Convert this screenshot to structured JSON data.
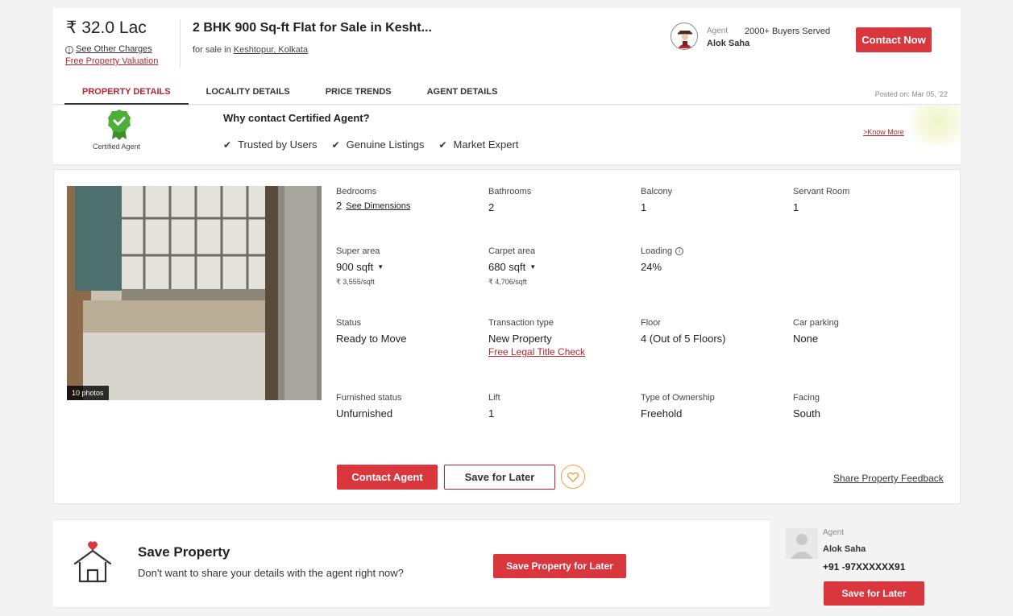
{
  "header": {
    "price": "₹ 32.0 Lac",
    "see_other_charges": "See Other Charges",
    "free_valuation": "Free Property Valuation",
    "title": "2 BHK 900 Sq-ft Flat for Sale in Kesht...",
    "subtitle_prefix": "for sale in ",
    "subtitle_location": "Keshtopur, Kolkata",
    "agent_label": "Agent",
    "agent_name": "Alok Saha",
    "buyers_served": "2000+ Buyers Served",
    "contact_now": "Contact Now",
    "posted_on": "Posted on: Mar 05, '22"
  },
  "tabs": [
    {
      "label": "PROPERTY DETAILS",
      "active": true
    },
    {
      "label": "LOCALITY DETAILS",
      "active": false
    },
    {
      "label": "PRICE TRENDS",
      "active": false
    },
    {
      "label": "AGENT DETAILS",
      "active": false
    }
  ],
  "certified": {
    "badge_label": "Certified Agent",
    "title": "Why contact Certified Agent?",
    "points": [
      "Trusted by Users",
      "Genuine Listings",
      "Market Expert"
    ],
    "know_more": ">Know More"
  },
  "photo": {
    "count_label": "10 photos"
  },
  "details": {
    "bedrooms": {
      "label": "Bedrooms",
      "value": "2",
      "link": "See Dimensions"
    },
    "bathrooms": {
      "label": "Bathrooms",
      "value": "2"
    },
    "balcony": {
      "label": "Balcony",
      "value": "1"
    },
    "servant_room": {
      "label": "Servant Room",
      "value": "1"
    },
    "super_area": {
      "label": "Super area",
      "value": "900 sqft",
      "sub": "₹ 3,555/sqft"
    },
    "carpet_area": {
      "label": "Carpet area",
      "value": "680 sqft",
      "sub": "₹ 4,706/sqft"
    },
    "loading": {
      "label": "Loading",
      "value": "24%"
    },
    "status": {
      "label": "Status",
      "value": "Ready to Move"
    },
    "transaction": {
      "label": "Transaction type",
      "value": "New Property",
      "link": "Free Legal Title Check"
    },
    "floor": {
      "label": "Floor",
      "value": "4 (Out of 5 Floors)"
    },
    "car_parking": {
      "label": "Car parking",
      "value": "None"
    },
    "furnished": {
      "label": "Furnished status",
      "value": "Unfurnished"
    },
    "lift": {
      "label": "Lift",
      "value": "1"
    },
    "ownership": {
      "label": "Type of Ownership",
      "value": "Freehold"
    },
    "facing": {
      "label": "Facing",
      "value": "South"
    }
  },
  "actions": {
    "contact_agent": "Contact Agent",
    "save_for_later": "Save for Later",
    "share_feedback": "Share Property Feedback"
  },
  "save_property": {
    "title": "Save Property",
    "subtitle": "Don't want to share your details with the agent right now?",
    "button": "Save Property for Later"
  },
  "agent_card": {
    "label": "Agent",
    "name": "Alok Saha",
    "phone": "+91 -97XXXXXX91",
    "button": "Save for Later"
  },
  "colors": {
    "accent": "#d9363e",
    "link_red": "#b5262e",
    "heart_outline": "#e7a34b",
    "badge_green": "#4caf3a"
  }
}
